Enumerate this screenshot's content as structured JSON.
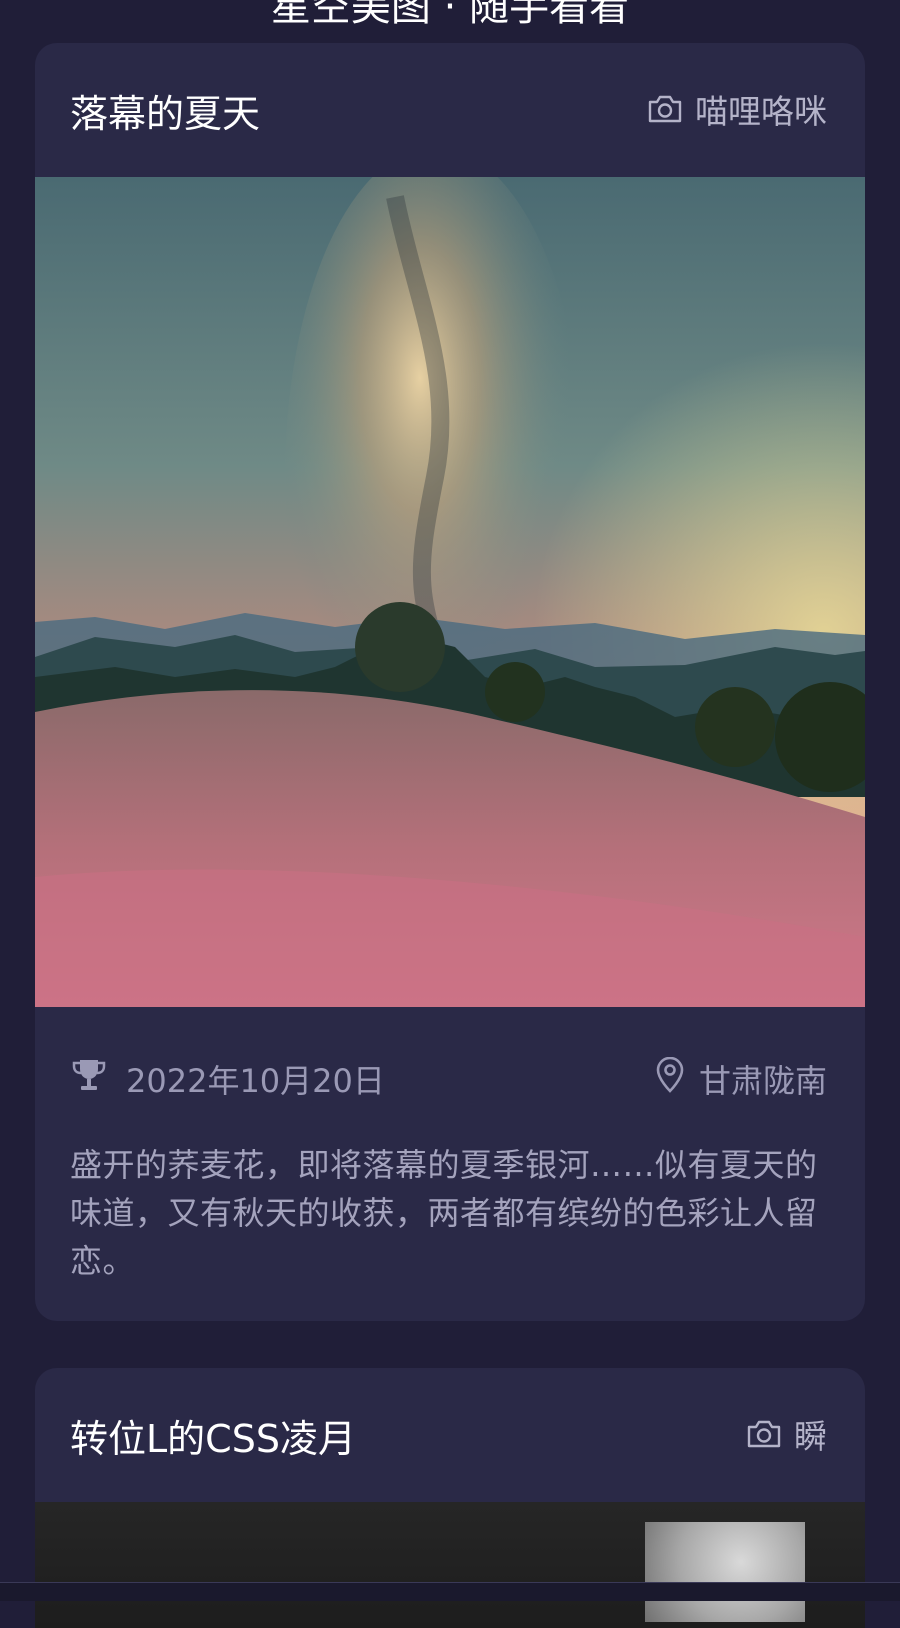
{
  "header": {
    "title": "星空美图 · 随手看看"
  },
  "cards": [
    {
      "title": "落幕的夏天",
      "author": "喵哩咯咪",
      "date": "2022年10月20日",
      "location": "甘肃陇南",
      "description": "盛开的荞麦花，即将落幕的夏季银河……似有夏天的味道，又有秋天的收获，两者都有缤纷的色彩让人留恋。"
    },
    {
      "title": "转位L的CSS凌月",
      "author": "瞬"
    }
  ],
  "icons": {
    "camera": "camera-icon",
    "trophy": "trophy-icon",
    "location": "location-pin-icon"
  },
  "colors": {
    "background": "#201e38",
    "card": "#2a2947",
    "muted_text": "#9a99b5"
  }
}
